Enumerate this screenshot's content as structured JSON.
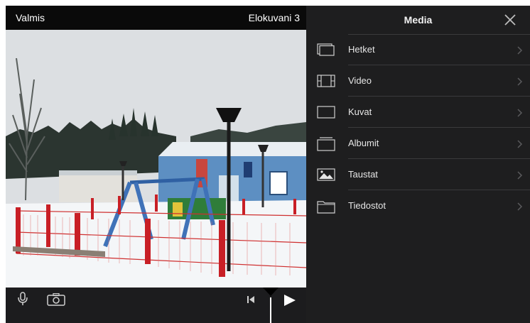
{
  "editor": {
    "done_label": "Valmis",
    "project_title": "Elokuvani 3"
  },
  "media_panel": {
    "title": "Media",
    "items": [
      {
        "label": "Hetket",
        "icon": "moments-icon"
      },
      {
        "label": "Video",
        "icon": "film-strip-icon"
      },
      {
        "label": "Kuvat",
        "icon": "photo-frame-icon"
      },
      {
        "label": "Albumit",
        "icon": "albums-icon"
      },
      {
        "label": "Taustat",
        "icon": "landscape-icon"
      },
      {
        "label": "Tiedostot",
        "icon": "folder-icon"
      }
    ]
  },
  "toolbar": {
    "icons": [
      "microphone-icon",
      "camera-icon",
      "skip-to-start-icon",
      "play-icon"
    ]
  },
  "colors": {
    "panel_bg": "#1e1e1f",
    "toolbar_bg": "#1c1c1e",
    "divider": "#3a3a3c"
  }
}
